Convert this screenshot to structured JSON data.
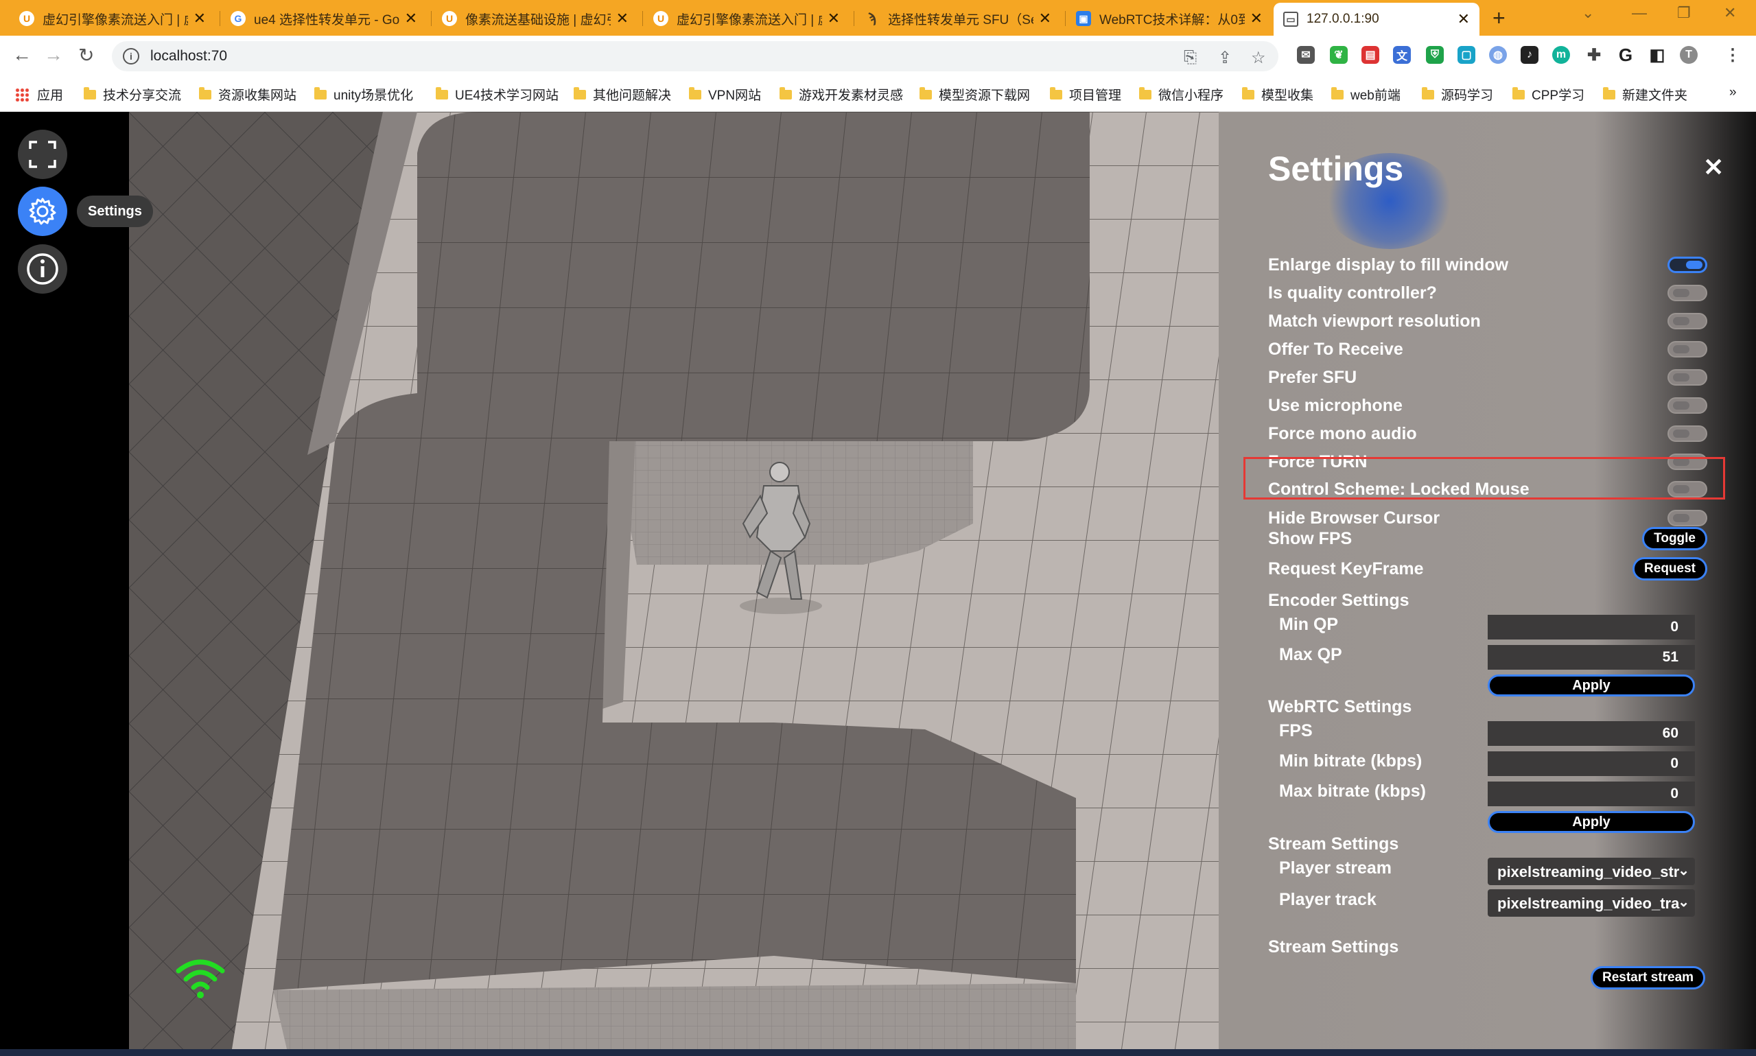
{
  "browser": {
    "tabs": [
      {
        "title": "虚幻引擎像素流送入门 | 虚",
        "favicon": "U"
      },
      {
        "title": "ue4 选择性转发单元 - Go",
        "favicon": "G"
      },
      {
        "title": "像素流送基础设施 | 虚幻引",
        "favicon": "U"
      },
      {
        "title": "虚幻引擎像素流送入门 | 虚",
        "favicon": "U"
      },
      {
        "title": "选择性转发单元 SFU（Sel",
        "favicon": "SFU"
      },
      {
        "title": "WebRTC技术详解：从0到",
        "favicon": "W"
      },
      {
        "title": "127.0.0.1:90",
        "favicon": "page"
      }
    ],
    "address": "localhost:70",
    "bookmarks": [
      "应用",
      "技术分享交流",
      "资源收集网站",
      "unity场景优化",
      "UE4技术学习网站",
      "其他问题解决",
      "VPN网站",
      "游戏开发素材灵感",
      "模型资源下载网",
      "项目管理",
      "微信小程序",
      "模型收集",
      "web前端",
      "源码学习",
      "CPP学习",
      "新建文件夹"
    ],
    "profile_initial": "T",
    "more_bookmarks": "»"
  },
  "rail": {
    "settings_tooltip": "Settings"
  },
  "settings": {
    "title": "Settings",
    "close": "✕",
    "toggles": [
      {
        "label": "Enlarge display to fill window",
        "on": true
      },
      {
        "label": "Is quality controller?",
        "on": false
      },
      {
        "label": "Match viewport resolution",
        "on": false
      },
      {
        "label": "Offer To Receive",
        "on": false
      },
      {
        "label": "Prefer SFU",
        "on": false
      },
      {
        "label": "Use microphone",
        "on": false
      },
      {
        "label": "Force mono audio",
        "on": false
      },
      {
        "label": "Force TURN",
        "on": false
      },
      {
        "label": "Control Scheme: Locked Mouse",
        "on": false
      },
      {
        "label": "Hide Browser Cursor",
        "on": false
      }
    ],
    "show_fps": {
      "label": "Show FPS",
      "button": "Toggle"
    },
    "keyframe": {
      "label": "Request KeyFrame",
      "button": "Request"
    },
    "encoder": {
      "heading": "Encoder Settings",
      "min_qp_label": "Min QP",
      "min_qp": "0",
      "max_qp_label": "Max QP",
      "max_qp": "51",
      "apply": "Apply"
    },
    "webrtc": {
      "heading": "WebRTC Settings",
      "fps_label": "FPS",
      "fps": "60",
      "min_bitrate_label": "Min bitrate (kbps)",
      "min_bitrate": "0",
      "max_bitrate_label": "Max bitrate (kbps)",
      "max_bitrate": "0",
      "apply": "Apply"
    },
    "stream": {
      "heading": "Stream Settings",
      "player_stream_label": "Player stream",
      "player_stream": "pixelstreaming_video_str",
      "player_track_label": "Player track",
      "player_track": "pixelstreaming_video_tra"
    },
    "stream2": {
      "heading": "Stream Settings",
      "restart": "Restart stream"
    }
  },
  "colors": {
    "accent": "#3b82f6",
    "tabbar": "#f5a623",
    "highlight": "#e53935",
    "wifi": "#22dd22"
  }
}
